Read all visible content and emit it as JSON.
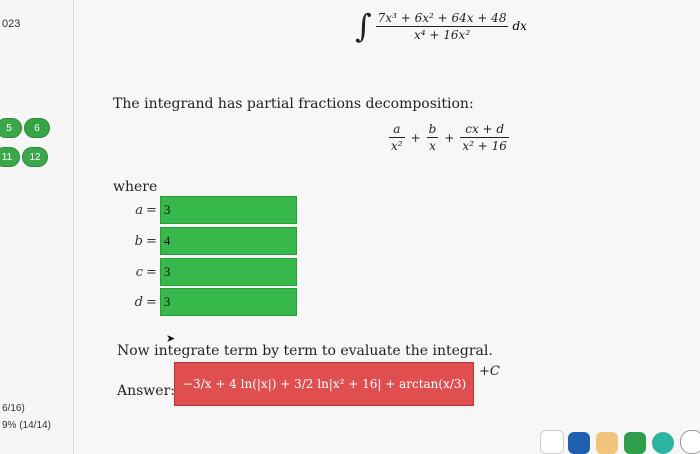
{
  "sidebar": {
    "year_fragment": "023",
    "question_nums": [
      "5",
      "6",
      "11",
      "12"
    ],
    "score_lines": [
      "6/16)",
      "9% (14/14)"
    ]
  },
  "problem": {
    "integrand_numerator": "7x³ + 6x² + 64x + 48",
    "integrand_denominator": "x⁴ + 16x²",
    "differential": "dx"
  },
  "intro_text": "The integrand has partial fractions decomposition:",
  "decomposition": {
    "f1_num": "a",
    "f1_den": "x²",
    "f2_num": "b",
    "f2_den": "x",
    "f3_num": "cx + d",
    "f3_den": "x² + 16",
    "plus": "+"
  },
  "where_text": "where",
  "coefficients": [
    {
      "var": "a",
      "eq": "=",
      "value": "3"
    },
    {
      "var": "b",
      "eq": "=",
      "value": "4"
    },
    {
      "var": "c",
      "eq": "=",
      "value": "3"
    },
    {
      "var": "d",
      "eq": "=",
      "value": "3"
    }
  ],
  "next_step_text": "Now integrate term by term to evaluate the integral.",
  "answer_label": "Answer:",
  "answer_value": "−3/x + 4 ln(|x|) + 3/2 ln|x² + 16| + arctan(x/3)",
  "plus_c": "+C",
  "colors": {
    "correct_green": "#37b84a",
    "incorrect_red": "#e04f4f",
    "badge_green": "#3aa84a"
  }
}
